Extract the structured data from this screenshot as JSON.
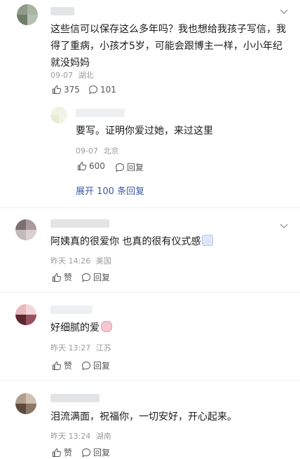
{
  "comments": [
    {
      "text_lines": [
        "这些信可以保存这么多年吗？我也想给我孩子写信，我",
        "得了重病，小孩才5岁，可能会跟博主一样，小小年纪",
        "就没妈妈"
      ],
      "time": "09-07",
      "location": "湖北",
      "likes": "375",
      "replies": "101"
    },
    {
      "text": "要写。证明你爱过她，来过这里",
      "time": "09-07",
      "location": "北京",
      "likes": "600",
      "reply_label": "回复",
      "expand_label": "展开 100 条回复"
    },
    {
      "text": "阿姨真的很爱你 也真的很有仪式感",
      "emoji_icon": "pray-hands-emoji",
      "time": "昨天 14:26",
      "location": "美国",
      "like_label": "赞",
      "reply_label": "回复"
    },
    {
      "text": "好细腻的爱",
      "emoji_icon": "pig-face-emoji",
      "time": "昨天 13:27",
      "location": "江苏",
      "like_label": "赞",
      "reply_label": "回复"
    },
    {
      "text": "泪流满面，祝福你，一切安好，开心起来。",
      "time": "昨天 13:24",
      "location": "湖南",
      "like_label": "赞",
      "reply_label": "回复"
    }
  ],
  "colors": {
    "link": "#3a5ba8",
    "meta": "#9b9b9b",
    "text": "#1a1a1a"
  },
  "icons": [
    "thumb-up-icon",
    "comment-bubble-icon",
    "more-options-icon"
  ]
}
